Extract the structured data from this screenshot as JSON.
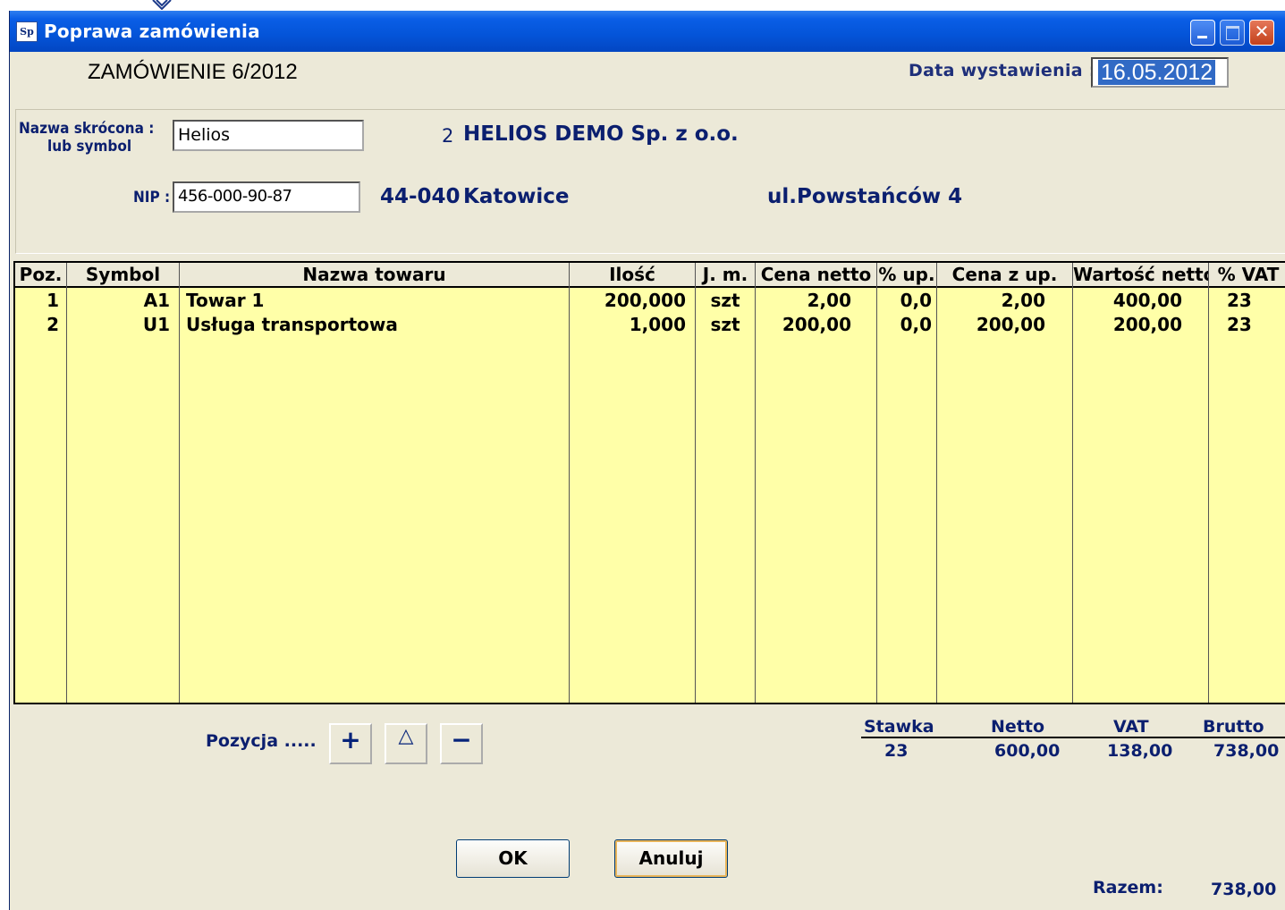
{
  "window": {
    "title": "Poprawa zamówienia",
    "icon_text": "Sp",
    "close_glyph": "✕"
  },
  "header": {
    "doc_title": "ZAMÓWIENIE 6/2012",
    "date_label": "Data wystawienia :",
    "date_value": "16.05.2012"
  },
  "customer": {
    "short_name_label_1": "Nazwa skrócona :",
    "short_name_label_2": "lub symbol",
    "short_name_value": "Helios",
    "number": "2",
    "full_name": "HELIOS DEMO Sp. z o.o.",
    "nip_label": "NIP :",
    "nip_value": "456-000-90-87",
    "postcode": "44-040",
    "city": "Katowice",
    "street": "ul.Powstańców 4"
  },
  "table": {
    "columns": [
      "Poz.",
      "Symbol",
      "Nazwa towaru",
      "Ilość",
      "J. m.",
      "Cena netto",
      "% up.",
      "Cena z up.",
      "Wartość netto",
      "% VAT"
    ],
    "rows": [
      [
        "1",
        "A1",
        "Towar 1",
        "200,000",
        "szt",
        "2,00",
        "0,0",
        "2,00",
        "400,00",
        "23"
      ],
      [
        "2",
        "U1",
        "Usługa transportowa",
        "1,000",
        "szt",
        "200,00",
        "0,0",
        "200,00",
        "200,00",
        "23"
      ]
    ]
  },
  "position": {
    "label": "Pozycja .....",
    "add_glyph": "+",
    "edit_glyph": "△",
    "remove_glyph": "−"
  },
  "summary": {
    "headers": [
      "Stawka",
      "Netto",
      "VAT",
      "Brutto"
    ],
    "values": [
      "23",
      "600,00",
      "138,00",
      "738,00"
    ]
  },
  "buttons": {
    "ok": "OK",
    "cancel": "Anuluj"
  },
  "total": {
    "label": "Razem:",
    "value": "738,00"
  }
}
